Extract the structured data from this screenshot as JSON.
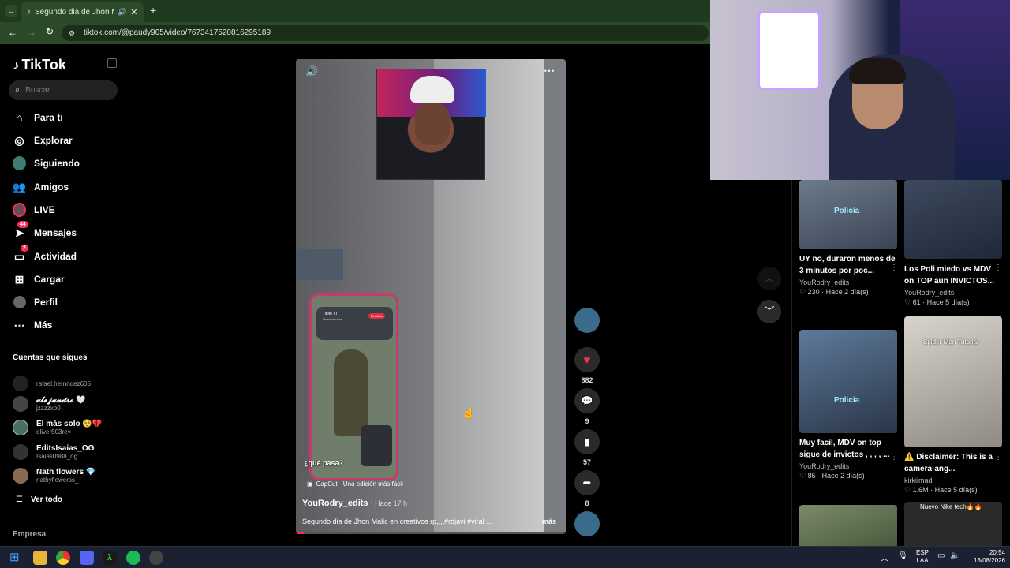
{
  "browser": {
    "tab_title": "Segundo dia de Jhon Malic",
    "url": "tiktok.com/@paudy905/video/7673417520816295189"
  },
  "sidebar": {
    "logo": "TikTok",
    "search_placeholder": "Buscar",
    "nav": [
      {
        "label": "Para ti",
        "icon": "home-icon"
      },
      {
        "label": "Explorar",
        "icon": "compass-icon"
      },
      {
        "label": "Siguiendo",
        "icon": "following-avatar-icon"
      },
      {
        "label": "Amigos",
        "icon": "friends-icon"
      },
      {
        "label": "LIVE",
        "icon": "live-icon"
      },
      {
        "label": "Mensajes",
        "icon": "messages-icon",
        "badge": "44"
      },
      {
        "label": "Actividad",
        "icon": "activity-icon",
        "badge": "2"
      },
      {
        "label": "Cargar",
        "icon": "upload-icon"
      },
      {
        "label": "Perfil",
        "icon": "profile-icon"
      },
      {
        "label": "Más",
        "icon": "more-icon"
      }
    ],
    "following_title": "Cuentas que sigues",
    "accounts": [
      {
        "name": "",
        "handle": "rafael.hernndez605"
      },
      {
        "name": "𝓪𝓵𝓮𝓳𝓪𝓷𝓭𝓻𝓸 🤍",
        "handle": "jzzzzxp0"
      },
      {
        "name": "El más solo 🥺💔",
        "handle": "oliver503rey"
      },
      {
        "name": "EditsIsaias_OG",
        "handle": "Isaias0988_og"
      },
      {
        "name": "Nath flowers 💎",
        "handle": "nathyflowerss_"
      }
    ],
    "see_all": "Ver todo",
    "footer": "Empresa"
  },
  "video": {
    "overlay_question": "¿qué pasa?",
    "capcut_label": "CapCut · Una edición más fácil",
    "phone_call_name": "Tikito TTT",
    "phone_call_sub": "Videollamada",
    "phone_end": "Finalizar",
    "author": "YouRodry_edits",
    "time_ago": "Hace 17 h",
    "caption": "Segundo dia de Jhon Malic en creativos rp,,,,#rdjavi #viral ...",
    "more": "más"
  },
  "actions": {
    "likes": "882",
    "comments": "9",
    "saves": "57",
    "shares": "8"
  },
  "related": [
    {
      "title": "UY no, duraron menos de 3 minutos por poc...",
      "author": "YouRodry_edits",
      "likes": "230",
      "ago": "Hace 2 día(s)",
      "overlay": "Policia"
    },
    {
      "title": "Los Poli miedo vs MDV on TOP aun INVICTOS...",
      "author": "YouRodry_edits",
      "likes": "61",
      "ago": "Hace 5 día(s)",
      "overlay": ""
    },
    {
      "title": "Muy facil, MDV on top sigue de invictos , , , , ...",
      "author": "YouRodry_edits",
      "likes": "85",
      "ago": "Hace 2 día(s)",
      "overlay": "Policia"
    },
    {
      "title": "⚠️ Disclaimer: This is a camera-ang...",
      "author": "kirkiimad",
      "likes": "1.6M",
      "ago": "Hace 5 día(s)",
      "overlay": "Spider-Man Tutorial"
    }
  ],
  "next_thumb_overlay": "Nuevo Nike tech🔥🔥",
  "taskbar": {
    "lang": "ESP",
    "lang2": "LAA",
    "time": "20:54",
    "date": "13/08/2026"
  },
  "colors": {
    "browser_green": "#1f3a1f",
    "like_red": "#fe2c55",
    "taskbar": "#1c2131"
  }
}
